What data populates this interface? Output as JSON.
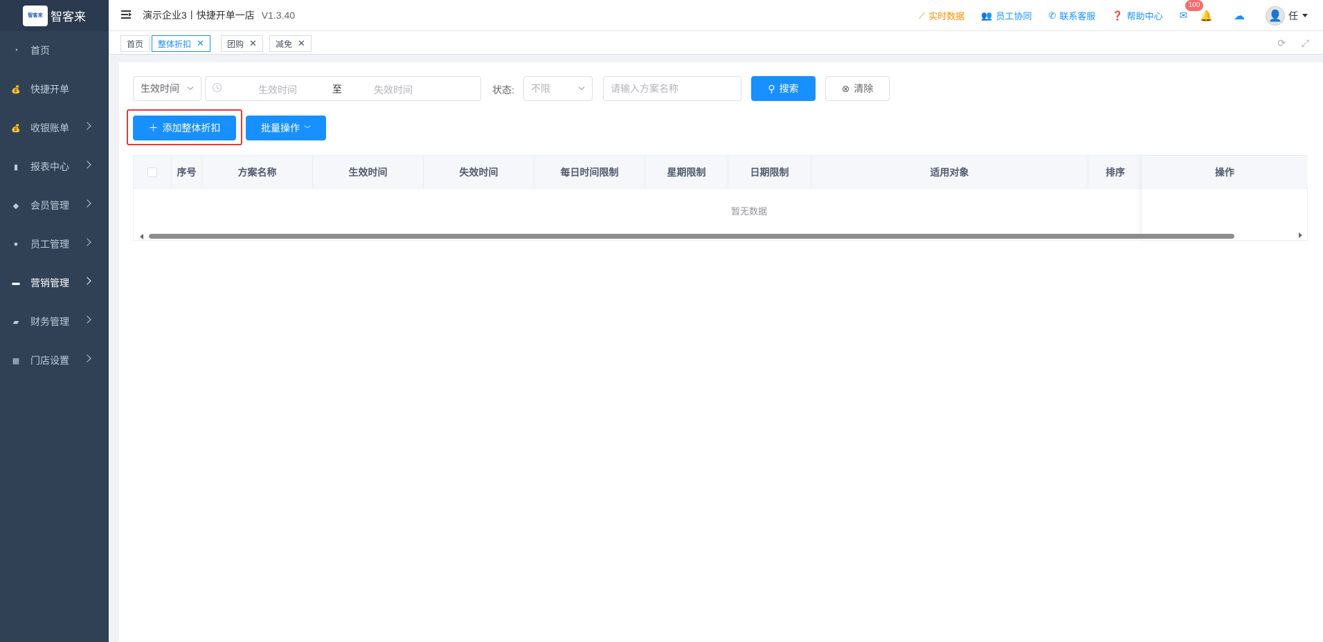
{
  "sidebar": {
    "logo_badge": "智客来",
    "logo_text": "智客来",
    "items": [
      {
        "label": "首页",
        "icon": "dashboard-icon",
        "expandable": false
      },
      {
        "label": "快捷开单",
        "icon": "money-bag-icon",
        "expandable": false
      },
      {
        "label": "收银账单",
        "icon": "money-bag-icon",
        "expandable": true
      },
      {
        "label": "报表中心",
        "icon": "bar-chart-icon",
        "expandable": true
      },
      {
        "label": "会员管理",
        "icon": "diamond-icon",
        "expandable": true
      },
      {
        "label": "员工管理",
        "icon": "user-icon",
        "expandable": true
      },
      {
        "label": "营销管理",
        "icon": "briefcase-icon",
        "expandable": true,
        "active": true
      },
      {
        "label": "财务管理",
        "icon": "wallet-icon",
        "expandable": true
      },
      {
        "label": "门店设置",
        "icon": "grid-icon",
        "expandable": true
      }
    ]
  },
  "header": {
    "store_name": "演示企业3丨快捷开单一店",
    "version": "V1.3.40",
    "links": {
      "realtime": "实时数据",
      "staff": "员工协同",
      "contact": "联系客服",
      "help": "帮助中心"
    },
    "mail_badge": "100",
    "user_name": "任"
  },
  "tags": [
    {
      "label": "首页",
      "closable": false,
      "active": false
    },
    {
      "label": "整体折扣",
      "closable": true,
      "active": true
    },
    {
      "label": "团购",
      "closable": true,
      "active": false
    },
    {
      "label": "减免",
      "closable": true,
      "active": false
    }
  ],
  "filters": {
    "time_type": "生效时间",
    "start_placeholder": "生效时间",
    "range_separator": "至",
    "end_placeholder": "失效时间",
    "status_label": "状态:",
    "status_value": "不限",
    "name_placeholder": "请输入方案名称",
    "search_label": "搜索",
    "clear_label": "清除"
  },
  "actions": {
    "add_label": "添加整体折扣",
    "batch_label": "批量操作"
  },
  "table": {
    "columns": [
      "序号",
      "方案名称",
      "生效时间",
      "失效时间",
      "每日时间限制",
      "星期限制",
      "日期限制",
      "适用对象",
      "排序"
    ],
    "fixed_column": "操作",
    "empty_text": "暂无数据"
  },
  "colors": {
    "sidebar_bg": "#304156",
    "primary": "#1890ff",
    "accent_orange": "#ff8c00",
    "highlight_red": "#e53935"
  }
}
